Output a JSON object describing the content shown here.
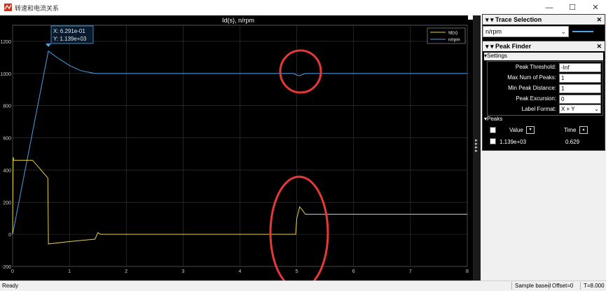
{
  "window": {
    "title": "转速和电流关系",
    "minimize": "—",
    "maximize": "☐",
    "close": "✕"
  },
  "plot": {
    "title": "Id(s), n/rpm",
    "legend": [
      "Id(s)",
      "n/rpm"
    ],
    "datatip": {
      "x": "X: 6.291e-01",
      "y": "Y: 1.139e+03"
    }
  },
  "chart_data": {
    "type": "line",
    "title": "Id(s), n/rpm",
    "xlabel": "",
    "ylabel": "",
    "xlim": [
      0,
      8
    ],
    "ylim": [
      -200,
      1300
    ],
    "xticks": [
      "0",
      "1",
      "2",
      "3",
      "4",
      "5",
      "6",
      "7",
      "8"
    ],
    "yticks": [
      "-200",
      "0",
      "200",
      "400",
      "600",
      "800",
      "1000",
      "1200"
    ],
    "grid": true,
    "legend_position": "top-right",
    "series": [
      {
        "name": "n/rpm",
        "color": "#4aa3e6",
        "x": [
          0,
          0.6291,
          0.8,
          1.0,
          1.2,
          1.45,
          2,
          3,
          4,
          4.95,
          5.0,
          5.05,
          5.15,
          6,
          7,
          8
        ],
        "y": [
          0,
          1139,
          1095,
          1050,
          1018,
          1000,
          1000,
          1000,
          1000,
          1000,
          990,
          986,
          1000,
          1000,
          1000,
          1000
        ]
      },
      {
        "name": "Id(s)",
        "color": "#e6d23a",
        "x": [
          0,
          0.01,
          0.02,
          0.35,
          0.5,
          0.62,
          0.63,
          1.0,
          1.45,
          1.5,
          1.55,
          1.6,
          2,
          3,
          4,
          4.98,
          5.0,
          5.05,
          5.1,
          5.15,
          5.2,
          6,
          7,
          8
        ],
        "y": [
          0,
          480,
          460,
          460,
          400,
          350,
          -60,
          -45,
          -30,
          10,
          0,
          0,
          0,
          0,
          0,
          0,
          100,
          170,
          150,
          125,
          125,
          125,
          125,
          125
        ]
      }
    ]
  },
  "trace_selection": {
    "title": "Trace Selection",
    "selected": "n/rpm",
    "close": "✕"
  },
  "peak_finder": {
    "title": "Peak Finder",
    "close": "✕",
    "settings_label": "Settings",
    "settings": [
      {
        "label": "Peak Threshold:",
        "value": "-Inf"
      },
      {
        "label": "Max Num of Peaks:",
        "value": "1"
      },
      {
        "label": "Min Peak Distance:",
        "value": "1"
      },
      {
        "label": "Peak Excursion:",
        "value": "0"
      },
      {
        "label": "Label Format:",
        "value": "X + Y"
      }
    ],
    "peaks_label": "Peaks",
    "columns": {
      "value": "Value",
      "time": "Time"
    },
    "rows": [
      {
        "value": "1.139e+03",
        "time": "0.629"
      }
    ]
  },
  "status": {
    "ready": "Ready",
    "sample": "Sample based",
    "offset": "Offset=0",
    "time": "T=8.000"
  }
}
